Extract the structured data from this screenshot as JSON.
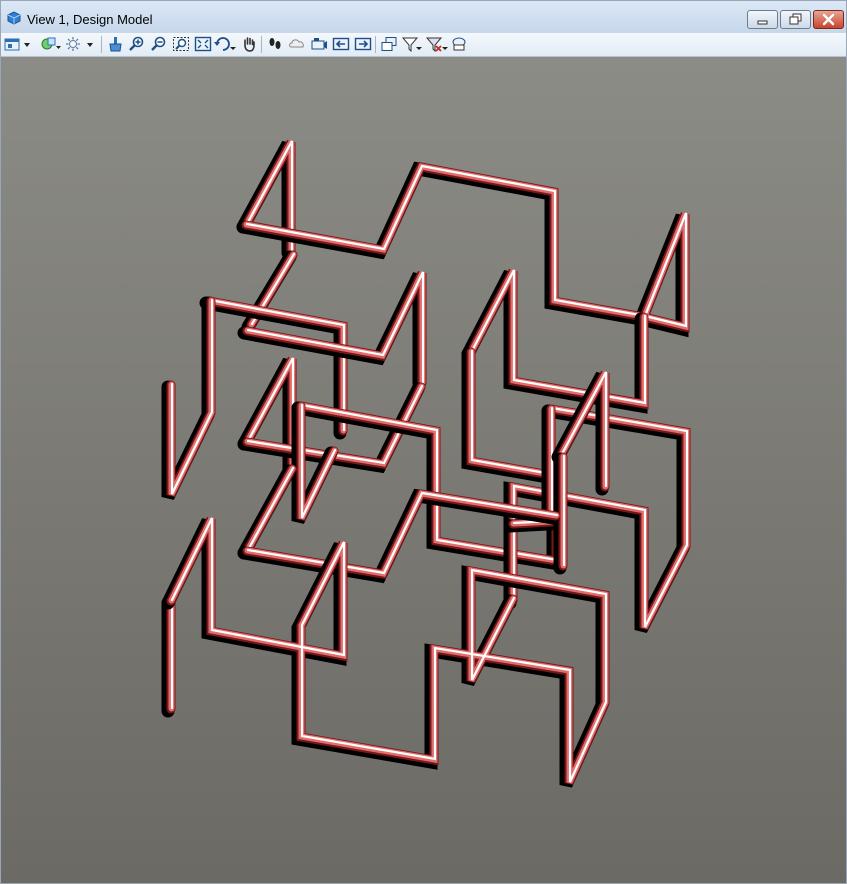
{
  "window": {
    "title": "View 1, Design Model",
    "buttons": [
      "minimize",
      "restore",
      "close"
    ]
  },
  "toolbar": {
    "items": [
      {
        "name": "view-attributes",
        "icon": "view-attributes-icon",
        "has_dropdown": true
      },
      {
        "name": "view-display-mode",
        "icon": "display-mode-icon",
        "has_dropdown": true
      },
      {
        "name": "lighting",
        "icon": "light-icon",
        "has_dropdown": true
      },
      {
        "name": "update-view",
        "icon": "brush-icon"
      },
      {
        "name": "zoom-in",
        "icon": "zoom-in-icon"
      },
      {
        "name": "zoom-out",
        "icon": "zoom-out-icon"
      },
      {
        "name": "window-area",
        "icon": "window-area-icon"
      },
      {
        "name": "fit-view",
        "icon": "fit-view-icon"
      },
      {
        "name": "rotate-view",
        "icon": "rotate-icon",
        "has_dropdown": true
      },
      {
        "name": "pan-view",
        "icon": "hand-icon"
      },
      {
        "name": "walk",
        "icon": "footprints-icon"
      },
      {
        "name": "fly",
        "icon": "cloud-icon"
      },
      {
        "name": "camera",
        "icon": "camera-icon"
      },
      {
        "name": "view-previous",
        "icon": "view-previous-icon"
      },
      {
        "name": "view-next",
        "icon": "view-next-icon"
      },
      {
        "name": "copy-view",
        "icon": "copy-view-icon"
      },
      {
        "name": "clip-volume",
        "icon": "clip-volume-icon",
        "has_dropdown": true
      },
      {
        "name": "clip-mask",
        "icon": "clip-mask-icon",
        "has_dropdown": true
      },
      {
        "name": "clear-clip",
        "icon": "clear-clip-icon"
      }
    ]
  },
  "colors": {
    "pipe_highlight": "#ffffff",
    "pipe_mid": "#e06e6e",
    "pipe_edge": "#7a1818",
    "pipe_shadow": "#000000",
    "background_top": "#8c8c87",
    "background_bottom": "#6b6a65"
  }
}
